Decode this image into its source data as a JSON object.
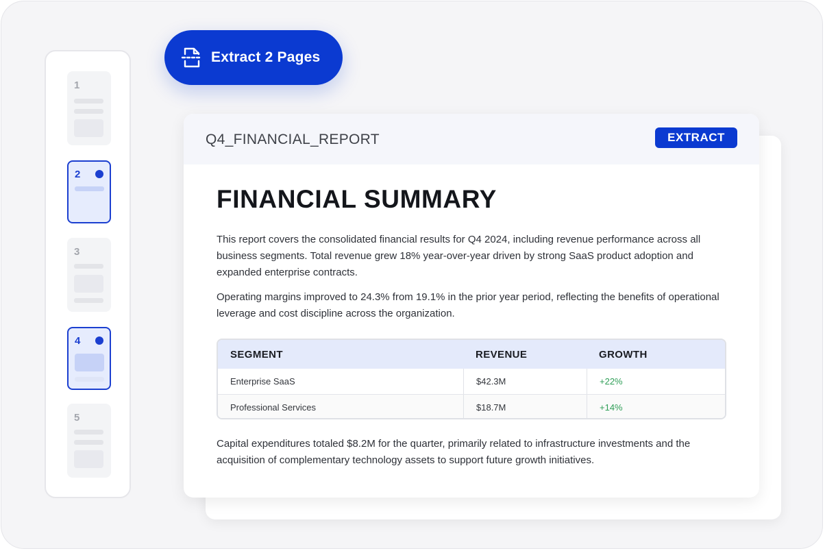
{
  "extract_button": {
    "label": "Extract 2 Pages",
    "icon": "extract-document-icon"
  },
  "sidebar": {
    "pages": [
      {
        "number": "1",
        "selected": false
      },
      {
        "number": "2",
        "selected": true
      },
      {
        "number": "3",
        "selected": false
      },
      {
        "number": "4",
        "selected": true
      },
      {
        "number": "5",
        "selected": false
      }
    ]
  },
  "document": {
    "filename": "Q4_FINANCIAL_REPORT",
    "badge": "EXTRACT",
    "title": "FINANCIAL SUMMARY",
    "paragraph1": "This report covers the consolidated financial results for Q4 2024, including revenue performance across all business segments. Total revenue grew 18% year-over-year driven by strong SaaS product adoption and expanded enterprise contracts.",
    "paragraph2": "Operating margins improved to 24.3% from 19.1% in the prior year period, reflecting the benefits of operational leverage and cost discipline across the organization.",
    "paragraph3": "Capital expenditures totaled $8.2M for the quarter, primarily related to infrastructure investments and the acquisition of complementary technology assets to support future growth initiatives.",
    "table": {
      "headers": [
        "SEGMENT",
        "REVENUE",
        "GROWTH"
      ],
      "rows": [
        [
          "Enterprise SaaS",
          "$42.3M",
          "+22%"
        ],
        [
          "Professional Services",
          "$18.7M",
          "+14%"
        ]
      ]
    }
  },
  "colors": {
    "accent": "#0b3ad1",
    "growth_positive": "#2f9e57",
    "table_header_bg": "#e4eafb"
  }
}
